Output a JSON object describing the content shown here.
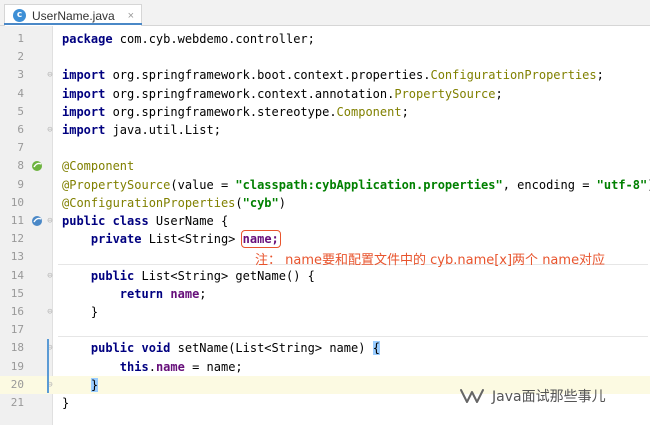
{
  "tab": {
    "file_name": "UserName.java",
    "type_letter": "c",
    "close_glyph": "×"
  },
  "lines": [
    {
      "no": "1",
      "tokens": [
        {
          "t": "package",
          "c": "kw"
        },
        {
          "t": " com.cyb.webdemo.controller;"
        }
      ]
    },
    {
      "no": "2",
      "tokens": []
    },
    {
      "no": "3",
      "tokens": [
        {
          "t": "import",
          "c": "kw"
        },
        {
          "t": " org.springframework.boot.context.properties."
        },
        {
          "t": "ConfigurationProperties",
          "c": "ann"
        },
        {
          "t": ";"
        }
      ]
    },
    {
      "no": "4",
      "tokens": [
        {
          "t": "import",
          "c": "kw"
        },
        {
          "t": " org.springframework.context.annotation."
        },
        {
          "t": "PropertySource",
          "c": "ann"
        },
        {
          "t": ";"
        }
      ]
    },
    {
      "no": "5",
      "tokens": [
        {
          "t": "import",
          "c": "kw"
        },
        {
          "t": " org.springframework.stereotype."
        },
        {
          "t": "Component",
          "c": "ann"
        },
        {
          "t": ";"
        }
      ]
    },
    {
      "no": "6",
      "tokens": [
        {
          "t": "import",
          "c": "kw"
        },
        {
          "t": " java.util.List;"
        }
      ]
    },
    {
      "no": "7",
      "tokens": []
    },
    {
      "no": "8",
      "tokens": [
        {
          "t": "@Component",
          "c": "ann"
        }
      ]
    },
    {
      "no": "9",
      "tokens": [
        {
          "t": "@PropertySource",
          "c": "ann"
        },
        {
          "t": "(value = "
        },
        {
          "t": "\"classpath:cybApplication.properties\"",
          "c": "str"
        },
        {
          "t": ", encoding = "
        },
        {
          "t": "\"utf-8\"",
          "c": "str"
        },
        {
          "t": ")"
        }
      ]
    },
    {
      "no": "10",
      "tokens": [
        {
          "t": "@ConfigurationProperties",
          "c": "ann"
        },
        {
          "t": "("
        },
        {
          "t": "\"cyb\"",
          "c": "str"
        },
        {
          "t": ")"
        }
      ]
    },
    {
      "no": "11",
      "tokens": [
        {
          "t": "public class",
          "c": "kw"
        },
        {
          "t": " UserName {"
        }
      ]
    },
    {
      "no": "12",
      "tokens": [
        {
          "t": "    "
        },
        {
          "t": "private",
          "c": "kw"
        },
        {
          "t": " List<String> "
        },
        {
          "t": "name;",
          "c": "fld boxed"
        }
      ]
    },
    {
      "no": "13",
      "tokens": []
    },
    {
      "no": "14",
      "tokens": [
        {
          "t": "    "
        },
        {
          "t": "public",
          "c": "kw"
        },
        {
          "t": " List<String> getName() {"
        }
      ]
    },
    {
      "no": "15",
      "tokens": [
        {
          "t": "        "
        },
        {
          "t": "return",
          "c": "kw"
        },
        {
          "t": " "
        },
        {
          "t": "name",
          "c": "fld"
        },
        {
          "t": ";"
        }
      ]
    },
    {
      "no": "16",
      "tokens": [
        {
          "t": "    }"
        }
      ]
    },
    {
      "no": "17",
      "tokens": []
    },
    {
      "no": "18",
      "tokens": [
        {
          "t": "    "
        },
        {
          "t": "public void",
          "c": "kw"
        },
        {
          "t": " setName(List<String> name) "
        },
        {
          "t": "{",
          "c": "bracematch"
        }
      ]
    },
    {
      "no": "19",
      "tokens": [
        {
          "t": "        "
        },
        {
          "t": "this",
          "c": "kw"
        },
        {
          "t": "."
        },
        {
          "t": "name",
          "c": "fld"
        },
        {
          "t": " = name;"
        }
      ]
    },
    {
      "no": "20",
      "tokens": [
        {
          "t": "    "
        },
        {
          "t": "}",
          "c": "bracematch"
        }
      ]
    },
    {
      "no": "21",
      "tokens": [
        {
          "t": "}"
        }
      ]
    }
  ],
  "annotation_note": "注：  name要和配置文件中的 cyb.name[x]两个 name对应",
  "watermark": {
    "text": "Java面试那些事儿",
    "icon": "wechat-channel-icon"
  },
  "colors": {
    "keyword": "#000080",
    "annotation": "#808000",
    "string": "#008000",
    "field": "#660e7a",
    "note": "#e8542d",
    "highlight_line": "#fcfae2"
  }
}
